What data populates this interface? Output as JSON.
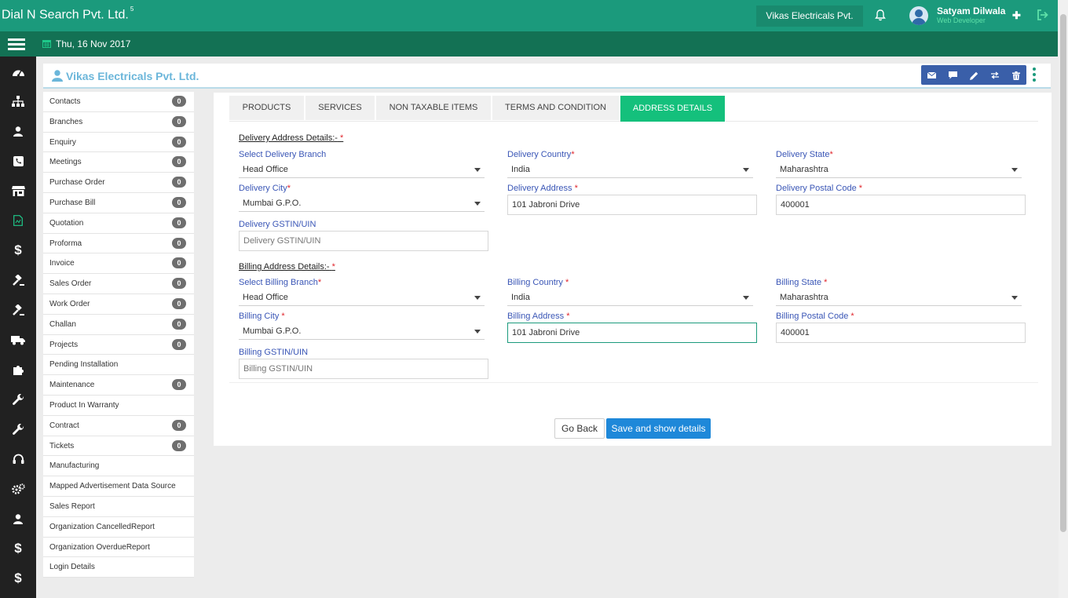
{
  "topbar": {
    "brand": "Dial N Search Pvt. Ltd.",
    "brand_sup": "5",
    "company_chip": "Vikas Electricals Pvt.",
    "user_name": "Satyam Dilwala",
    "user_role": "Web Developer",
    "bell_icon": "bell-icon",
    "plus_icon": "plus-icon",
    "logout_icon": "logout-icon"
  },
  "datebar": {
    "date": "Thu, 16 Nov 2017"
  },
  "icon_rail": [
    "dashboard-icon",
    "sitemap-icon",
    "user-icon",
    "phone-icon",
    "store-icon",
    "document-icon",
    "dollar-icon",
    "gavel-icon",
    "gavel-icon",
    "truck-icon",
    "puzzle-icon",
    "wrench-icon",
    "wrench-icon",
    "headset-icon",
    "gears-icon",
    "user-icon",
    "dollar-icon",
    "dollar-icon"
  ],
  "header": {
    "customer_name": "Vikas Electricals Pvt. Ltd.",
    "actions": [
      "email-icon",
      "comment-icon",
      "edit-icon",
      "refresh-icon",
      "trash-icon"
    ]
  },
  "side_list": [
    {
      "label": "Contacts",
      "badge": "0"
    },
    {
      "label": "Branches",
      "badge": "0"
    },
    {
      "label": "Enquiry",
      "badge": "0"
    },
    {
      "label": "Meetings",
      "badge": "0"
    },
    {
      "label": "Purchase Order",
      "badge": "0"
    },
    {
      "label": "Purchase Bill",
      "badge": "0"
    },
    {
      "label": "Quotation",
      "badge": "0"
    },
    {
      "label": "Proforma",
      "badge": "0"
    },
    {
      "label": "Invoice",
      "badge": "0"
    },
    {
      "label": "Sales Order",
      "badge": "0"
    },
    {
      "label": "Work Order",
      "badge": "0"
    },
    {
      "label": "Challan",
      "badge": "0"
    },
    {
      "label": "Projects",
      "badge": "0"
    },
    {
      "label": "Pending Installation",
      "badge": null
    },
    {
      "label": "Maintenance",
      "badge": "0"
    },
    {
      "label": "Product In Warranty",
      "badge": null
    },
    {
      "label": "Contract",
      "badge": "0"
    },
    {
      "label": "Tickets",
      "badge": "0"
    },
    {
      "label": "Manufacturing",
      "badge": null
    },
    {
      "label": "Mapped Advertisement Data Source",
      "badge": null
    },
    {
      "label": "Sales Report",
      "badge": null
    },
    {
      "label": "Organization CancelledReport",
      "badge": null
    },
    {
      "label": "Organization OverdueReport",
      "badge": null
    },
    {
      "label": "Login Details",
      "badge": null
    }
  ],
  "tabs": [
    "PRODUCTS",
    "SERVICES",
    "NON TAXABLE ITEMS",
    "TERMS AND CONDITION",
    "ADDRESS DETAILS"
  ],
  "active_tab": "ADDRESS DETAILS",
  "delivery": {
    "title": "Delivery Address Details:-",
    "branch_label": "Select Delivery Branch",
    "branch_value": "Head Office",
    "country_label": "Delivery Country",
    "country_value": "India",
    "state_label": "Delivery State",
    "state_value": "Maharashtra",
    "city_label": "Delivery City",
    "city_value": "Mumbai G.P.O.",
    "address_label": "Delivery Address",
    "address_value": "101 Jabroni Drive",
    "postal_label": "Delivery Postal Code",
    "postal_value": "400001",
    "gstin_label": "Delivery GSTIN/UIN",
    "gstin_placeholder": "Delivery GSTIN/UIN"
  },
  "billing": {
    "title": "Billing Address Details:-",
    "branch_label": "Select Billing Branch",
    "branch_value": "Head Office",
    "country_label": "Billing Country",
    "country_value": "India",
    "state_label": "Billing State",
    "state_value": "Maharashtra",
    "city_label": "Billing City",
    "city_value": "Mumbai G.P.O.",
    "address_label": "Billing Address",
    "address_value": "101 Jabroni Drive",
    "postal_label": "Billing Postal Code",
    "postal_value": "400001",
    "gstin_label": "Billing GSTIN/UIN",
    "gstin_placeholder": "Billing GSTIN/UIN"
  },
  "required_mark": "*",
  "buttons": {
    "go_back": "Go Back",
    "save": "Save and show details"
  },
  "colors": {
    "topbar": "#1b9a7c",
    "datebar": "#137154",
    "rail": "#212121",
    "active_tab": "#14c07c",
    "label": "#3a56b6",
    "primary_button": "#1e88d9"
  }
}
